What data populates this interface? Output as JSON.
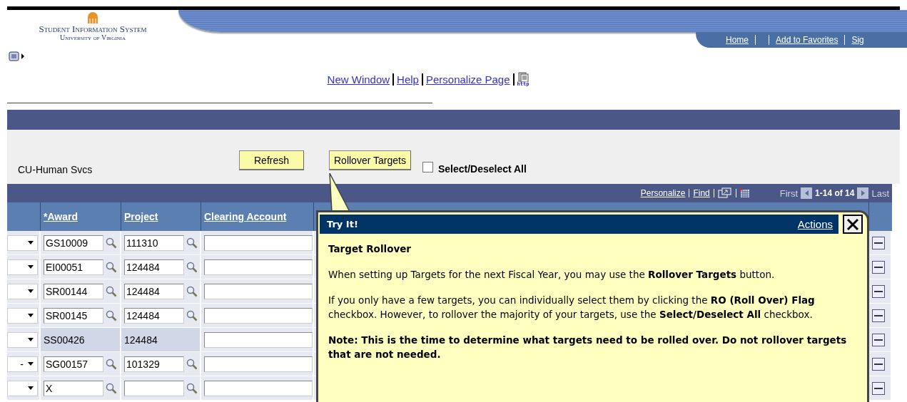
{
  "header": {
    "logo_title": "Student Information System",
    "logo_subtitle": "University of Virginia",
    "nav_links": [
      "Home",
      "Add to Favorites",
      "Sig"
    ]
  },
  "page_links": [
    "New Window",
    "Help",
    "Personalize Page"
  ],
  "http_icon_label": "http",
  "toolbar": {
    "unit": "CU-Human Svcs",
    "buttons": [
      "Refresh",
      "Rollover Targets"
    ],
    "select_all": {
      "label": "Select/Deselect All",
      "checked": false
    }
  },
  "grid": {
    "toolbar_links": [
      "Personalize",
      "Find"
    ],
    "first": "First",
    "range": "1-14 of 14",
    "last": "Last",
    "columns": [
      "*Award",
      "Project",
      "Clearing Account"
    ],
    "rows": [
      {
        "kind": "edit",
        "award": "GS10009",
        "project": "111310"
      },
      {
        "kind": "edit",
        "award": "EI00051",
        "project": "124484"
      },
      {
        "kind": "edit",
        "award": "SR00144",
        "project": "124484"
      },
      {
        "kind": "edit",
        "award": "SR00145",
        "project": "124484"
      },
      {
        "kind": "readonly",
        "award": "SS00426",
        "project": "124484"
      },
      {
        "kind": "edit",
        "award": "SG00157",
        "project": "101329",
        "column_1": "-"
      },
      {
        "kind": "edit",
        "award": "X"
      }
    ]
  },
  "popup": {
    "title": "Try It!",
    "actions": "Actions",
    "heading": "Target Rollover",
    "paragraphs": [
      {
        "kind": "plain",
        "text": "When setting up Targets for the next Fiscal Year, you may use the **Rollover Targets** button."
      },
      {
        "kind": "plain",
        "text": "If you only have a few targets, you can individually select them by clicking the **RO (Roll Over) Flag** checkbox. However, to rollover the majority of your targets, use the **Select/Deselect All** checkbox."
      },
      {
        "kind": "note",
        "text": "Note: This is the time to determine what targets need to be rolled over. Do not rollover targets that are not needed."
      }
    ]
  }
}
